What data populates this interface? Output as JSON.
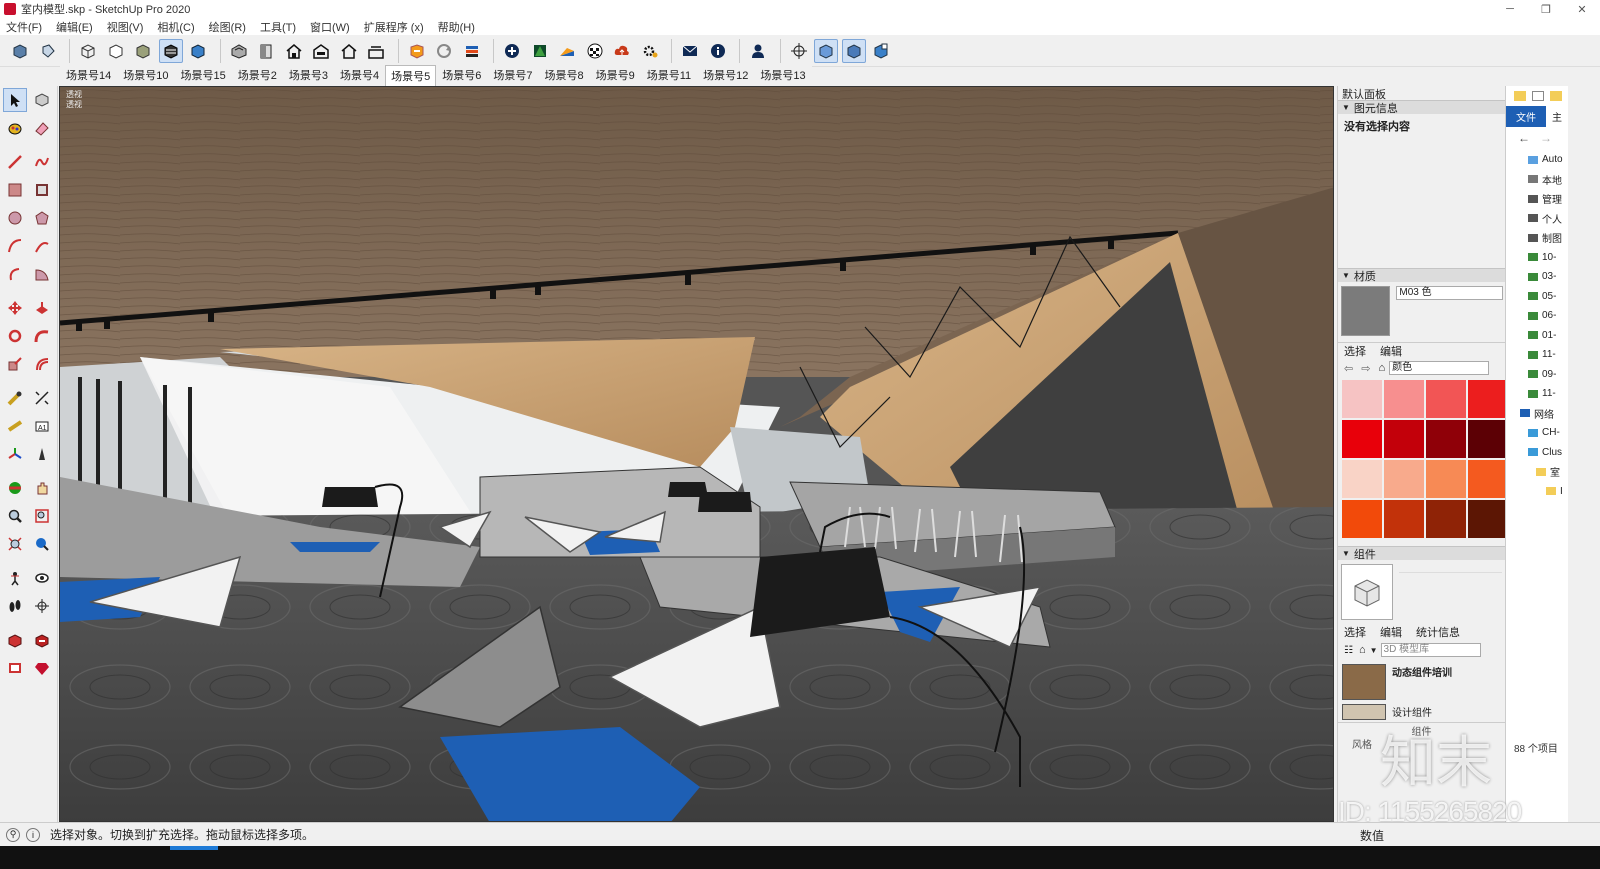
{
  "window": {
    "title": "室内模型.skp - SketchUp Pro 2020",
    "controls": [
      "─",
      "❐",
      "✕"
    ]
  },
  "menu": [
    "文件(F)",
    "编辑(E)",
    "视图(V)",
    "相机(C)",
    "绘图(R)",
    "工具(T)",
    "窗口(W)",
    "扩展程序 (x)",
    "帮助(H)"
  ],
  "toolbar_icons": [
    "component-icon",
    "paint-icon",
    "xray-icon",
    "backedge-icon",
    "wireframe-icon",
    "hidden-line-icon",
    "shaded-icon",
    "textured-icon",
    "iso-view-icon",
    "top-view-icon",
    "front-view-icon",
    "right-view-icon",
    "back-view-icon",
    "left-view-icon",
    "warehouse-icon",
    "sync-icon",
    "share-icon",
    "add-location-icon",
    "terrain-icon",
    "photo-texture-icon",
    "checker-icon",
    "cloud-upload-icon",
    "settings-icon",
    "mail-icon",
    "info-icon",
    "user-icon",
    "section-plane-icon",
    "section-display-icon",
    "section-cut-icon",
    "section-fill-icon"
  ],
  "scenes": {
    "tabs": [
      "场景号14",
      "场景号10",
      "场景号15",
      "场景号2",
      "场景号3",
      "场景号4",
      "场景号5",
      "场景号6",
      "场景号7",
      "场景号8",
      "场景号9",
      "场景号11",
      "场景号12",
      "场景号13"
    ],
    "active": "场景号5"
  },
  "viewport": {
    "label_line1": "透视",
    "label_line2": "透视"
  },
  "tray": {
    "title": "默认面板",
    "entity_info": {
      "header": "图元信息",
      "text": "没有选择内容"
    },
    "materials": {
      "header": "材质",
      "name": "M03 色",
      "tab_select": "选择",
      "tab_edit": "编辑",
      "library": "颜色",
      "swatches": [
        "#f6c3c3",
        "#f78f8f",
        "#f25555",
        "#ec1e1e",
        "#e8000a",
        "#c3000a",
        "#8f0008",
        "#5c0005",
        "#f9d3c6",
        "#f8aa8c",
        "#f78a55",
        "#f45a1f",
        "#f24a0a",
        "#c2320a",
        "#8f2306",
        "#5c1604",
        "#fbd9b8",
        "#f9c48f",
        "#f7a75a",
        "#f58a22"
      ]
    },
    "components": {
      "header": "组件",
      "tab_select": "选择",
      "tab_edit": "编辑",
      "tab_stats": "统计信息",
      "search_placeholder": "3D 模型库",
      "item_label": "动态组件培训",
      "item_label2": "设计组件",
      "footer": "组件",
      "count": "88 个项目"
    },
    "styles_label": "风格"
  },
  "explorer": {
    "tabs": [
      "文件",
      "主"
    ],
    "nav": [
      "←",
      "→"
    ],
    "items": [
      "Auto",
      "本地",
      "管理",
      "个人",
      "制图",
      "10-",
      "03-",
      "05-",
      "06-",
      "01-",
      "11-",
      "09-",
      "11-",
      "网络",
      "CH-",
      "Clus",
      "室",
      "I"
    ]
  },
  "status": {
    "text": "选择对象。切换到扩充选择。拖动鼠标选择多项。",
    "measure_label": "数值"
  },
  "watermark": {
    "logo": "知末",
    "id": "ID: 1155265820"
  },
  "colors": {
    "accent": "#1e7ad6",
    "ceiling_wood": "#7a6550",
    "wall_wood": "#c9a47c",
    "floor": "#4d4d4d",
    "upholstery_blue": "#1e5fb4"
  }
}
